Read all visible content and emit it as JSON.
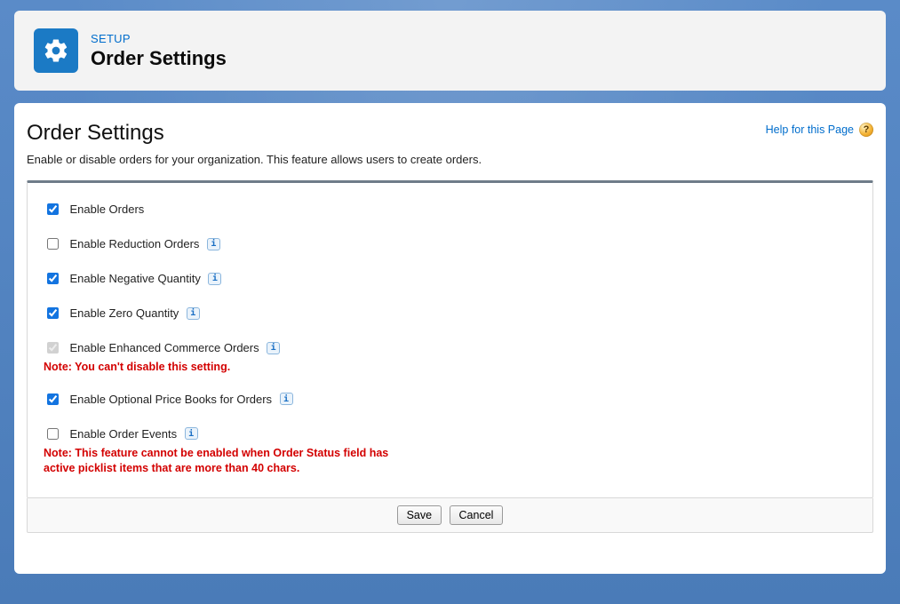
{
  "header": {
    "crumb": "SETUP",
    "title": "Order Settings"
  },
  "page": {
    "title": "Order Settings",
    "help_label": "Help for this Page",
    "description": "Enable or disable orders for your organization. This feature allows users to create orders."
  },
  "settings": {
    "enable_orders": {
      "label": "Enable Orders",
      "checked": true,
      "info": false,
      "disabled": false
    },
    "enable_reduction_orders": {
      "label": "Enable Reduction Orders",
      "checked": false,
      "info": true,
      "disabled": false
    },
    "enable_negative_quantity": {
      "label": "Enable Negative Quantity",
      "checked": true,
      "info": true,
      "disabled": false
    },
    "enable_zero_quantity": {
      "label": "Enable Zero Quantity",
      "checked": true,
      "info": true,
      "disabled": false
    },
    "enable_enhanced_commerce_orders": {
      "label": "Enable Enhanced Commerce Orders",
      "checked": true,
      "info": true,
      "disabled": true,
      "note": "Note: You can't disable this setting."
    },
    "enable_optional_price_books": {
      "label": "Enable Optional Price Books for Orders",
      "checked": true,
      "info": true,
      "disabled": false
    },
    "enable_order_events": {
      "label": "Enable Order Events",
      "checked": false,
      "info": true,
      "disabled": false,
      "note": "Note: This feature cannot be enabled when Order Status field has active picklist items that are more than 40 chars."
    }
  },
  "buttons": {
    "save": "Save",
    "cancel": "Cancel"
  }
}
